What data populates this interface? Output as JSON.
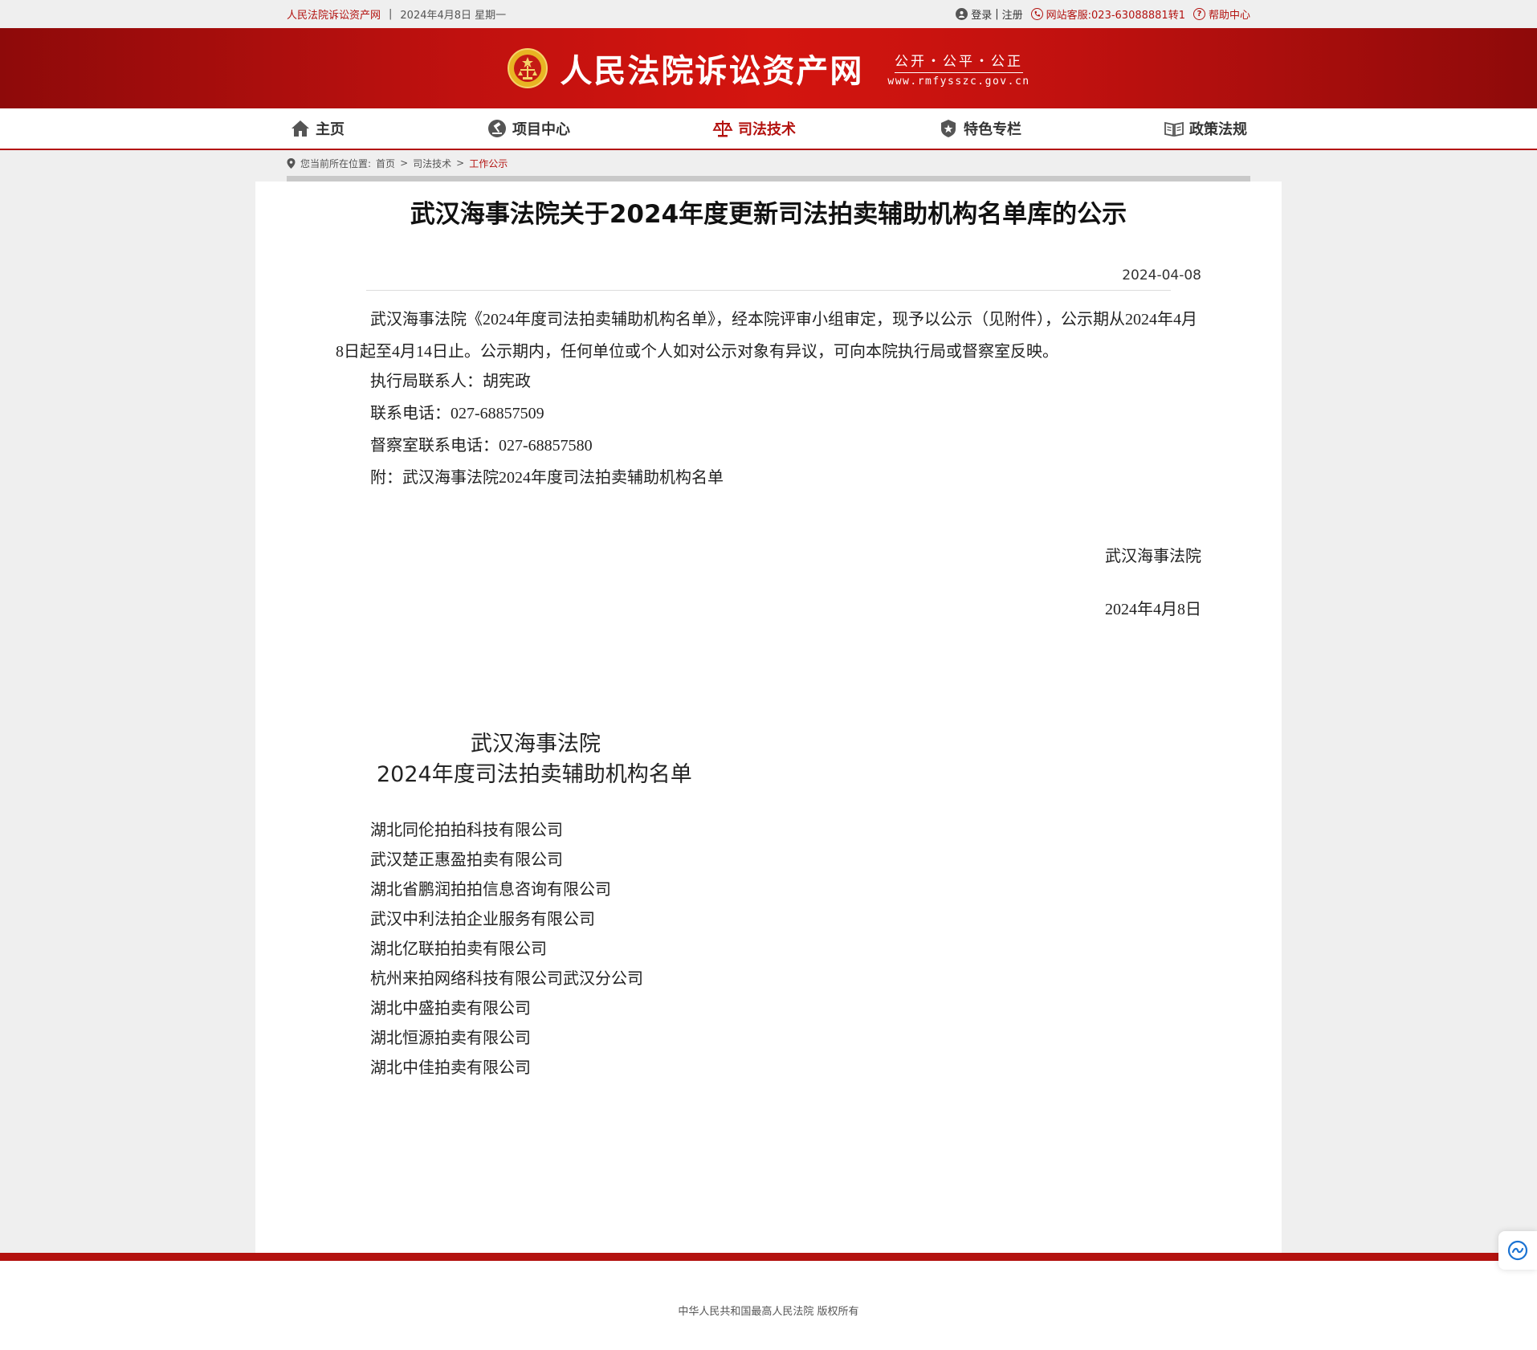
{
  "topbar": {
    "site_name": "人民法院诉讼资产网",
    "separator": "|",
    "date": "2024年4月8日  星期一",
    "login": "登录",
    "register": "注册",
    "pipe": "|",
    "hotline": "网站客服:023-63088881转1",
    "help": "帮助中心"
  },
  "banner": {
    "title": "人民法院诉讼资产网",
    "motto": "公开・公平・公正",
    "domain": "www.rmfysszc.gov.cn",
    "emblem_icon": "court-emblem-icon"
  },
  "nav": {
    "items": [
      {
        "label": "主页",
        "icon": "home-icon"
      },
      {
        "label": "项目中心",
        "icon": "gavel-icon"
      },
      {
        "label": "司法技术",
        "icon": "scales-icon",
        "active": true
      },
      {
        "label": "特色专栏",
        "icon": "badge-icon"
      },
      {
        "label": "政策法规",
        "icon": "book-icon"
      }
    ]
  },
  "breadcrumb": {
    "prefix": "您当前所在位置:",
    "home": "首页",
    "sep1": ">",
    "section": "司法技术",
    "sep2": ">",
    "current": "工作公示"
  },
  "article": {
    "title": "武汉海事法院关于2024年度更新司法拍卖辅助机构名单库的公示",
    "date": "2024-04-08",
    "paragraph": "武汉海事法院《2024年度司法拍卖辅助机构名单》，经本院评审小组审定，现予以公示（见附件），公示期从2024年4月8日起至4月14日止。公示期内，任何单位或个人如对公示对象有异议，可向本院执行局或督察室反映。",
    "contact_person": "执行局联系人：胡宪政",
    "contact_phone": "联系电话：027-68857509",
    "inspect_phone": "督察室联系电话：027-68857580",
    "attachment": "附：武汉海事法院2024年度司法拍卖辅助机构名单",
    "signature": "武汉海事法院",
    "signature_date": "2024年4月8日",
    "list_title_1": "武汉海事法院",
    "list_title_2": "2024年度司法拍卖辅助机构名单",
    "companies": [
      "湖北同伦拍拍科技有限公司",
      "武汉楚正惠盈拍卖有限公司",
      "湖北省鹏润拍拍信息咨询有限公司",
      "武汉中利法拍企业服务有限公司",
      "湖北亿联拍拍卖有限公司",
      "杭州来拍网络科技有限公司武汉分公司",
      "湖北中盛拍卖有限公司",
      "湖北恒源拍卖有限公司",
      "湖北中佳拍卖有限公司"
    ]
  },
  "footer": {
    "copyright": "中华人民共和国最高人民法院 版权所有"
  },
  "colors": {
    "brand_red": "#b3120f",
    "background": "#efefef"
  }
}
